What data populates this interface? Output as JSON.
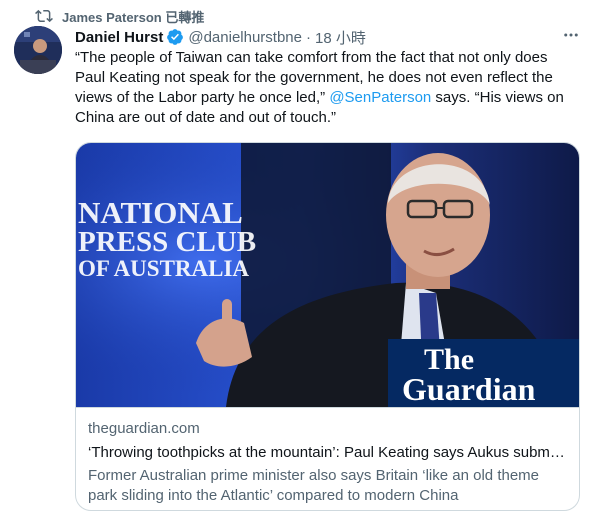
{
  "retweet": {
    "icon": "retweet-icon",
    "label": "James Paterson 已轉推"
  },
  "tweet": {
    "author_name": "Daniel Hurst",
    "verified_icon": "verified-badge-icon",
    "handle": "@danielhurstbne",
    "separator": "·",
    "time": "18 小時",
    "more_icon": "more-options-icon",
    "text_before": "“The people of Taiwan can take comfort from the fact that not only does Paul Keating not speak for the government, he does not even reflect the views of the Labor party he once led,” ",
    "mention": "@SenPaterson",
    "text_after": " says. “His views on China are out of date and out of touch.”"
  },
  "card": {
    "image": {
      "backdrop_text": [
        "NATIONAL",
        "PRESS CLUB",
        "OF AUSTRALIA"
      ],
      "logo_line1": "The",
      "logo_line2": "Guardian"
    },
    "domain": "theguardian.com",
    "title": "‘Throwing toothpicks at the mountain’: Paul Keating says Aukus subm…",
    "description": "Former Australian prime minister also says Britain ‘like an old theme park sliding into the Atlantic’ compared to modern China"
  },
  "colors": {
    "link": "#1d9bf0",
    "secondary_text": "#536471",
    "guardian_blue": "#052962"
  }
}
